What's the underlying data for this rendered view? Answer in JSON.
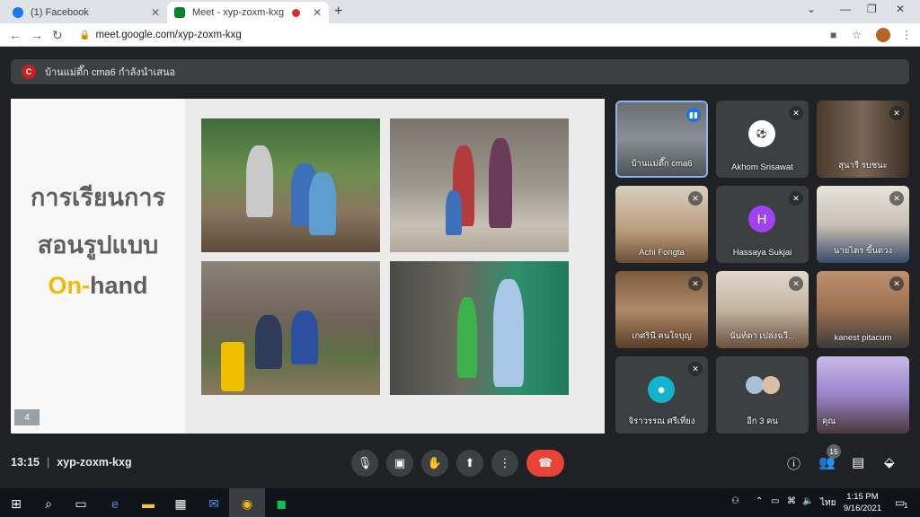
{
  "browser": {
    "tabs": [
      {
        "title": "(1) Facebook",
        "favicon": "facebook-icon"
      },
      {
        "title": "Meet - xyp-zoxm-kxg",
        "favicon": "meet-icon",
        "recording": true
      }
    ],
    "url": "meet.google.com/xyp-zoxm-kxg"
  },
  "presenter_banner": {
    "avatar_letter": "C",
    "text": "บ้านแม่ตึ๊ก cma6 กำลังนำเสนอ"
  },
  "slide": {
    "line1": "การเรียนการ",
    "line2": "สอนรูปแบบ",
    "line3a": "On-",
    "line3b": "hand",
    "page_number": "4"
  },
  "participants": [
    {
      "name": "บ้านแม่ตึ๊ก cma6",
      "mic": "speaking"
    },
    {
      "name": "Akhom Srisawat",
      "mic": "muted"
    },
    {
      "name": "สุนารี รบชนะ",
      "mic": "muted"
    },
    {
      "name": "Achi Fongta",
      "mic": "muted"
    },
    {
      "name": "Hassaya Sukjai",
      "mic": "muted",
      "avatar_letter": "H"
    },
    {
      "name": "นายไตร ขี้นดวง",
      "mic": "muted"
    },
    {
      "name": "เกศรินี คนใจบุญ",
      "mic": "muted"
    },
    {
      "name": "นันท์ดา เปล่งฉวี...",
      "mic": "muted"
    },
    {
      "name": "kanest pitacum",
      "mic": "muted"
    },
    {
      "name": "จิราวรรณ ศรีเที่ยง",
      "mic": "muted"
    },
    {
      "name": "อีก 3 คน"
    },
    {
      "name": "คุณ"
    }
  ],
  "bottom_bar": {
    "time": "13:15",
    "separator": "|",
    "meeting_code": "xyp-zoxm-kxg",
    "people_count": "15"
  },
  "taskbar": {
    "time": "1:15 PM",
    "date": "9/16/2021",
    "language": "ไทย",
    "notification_count": "1"
  }
}
